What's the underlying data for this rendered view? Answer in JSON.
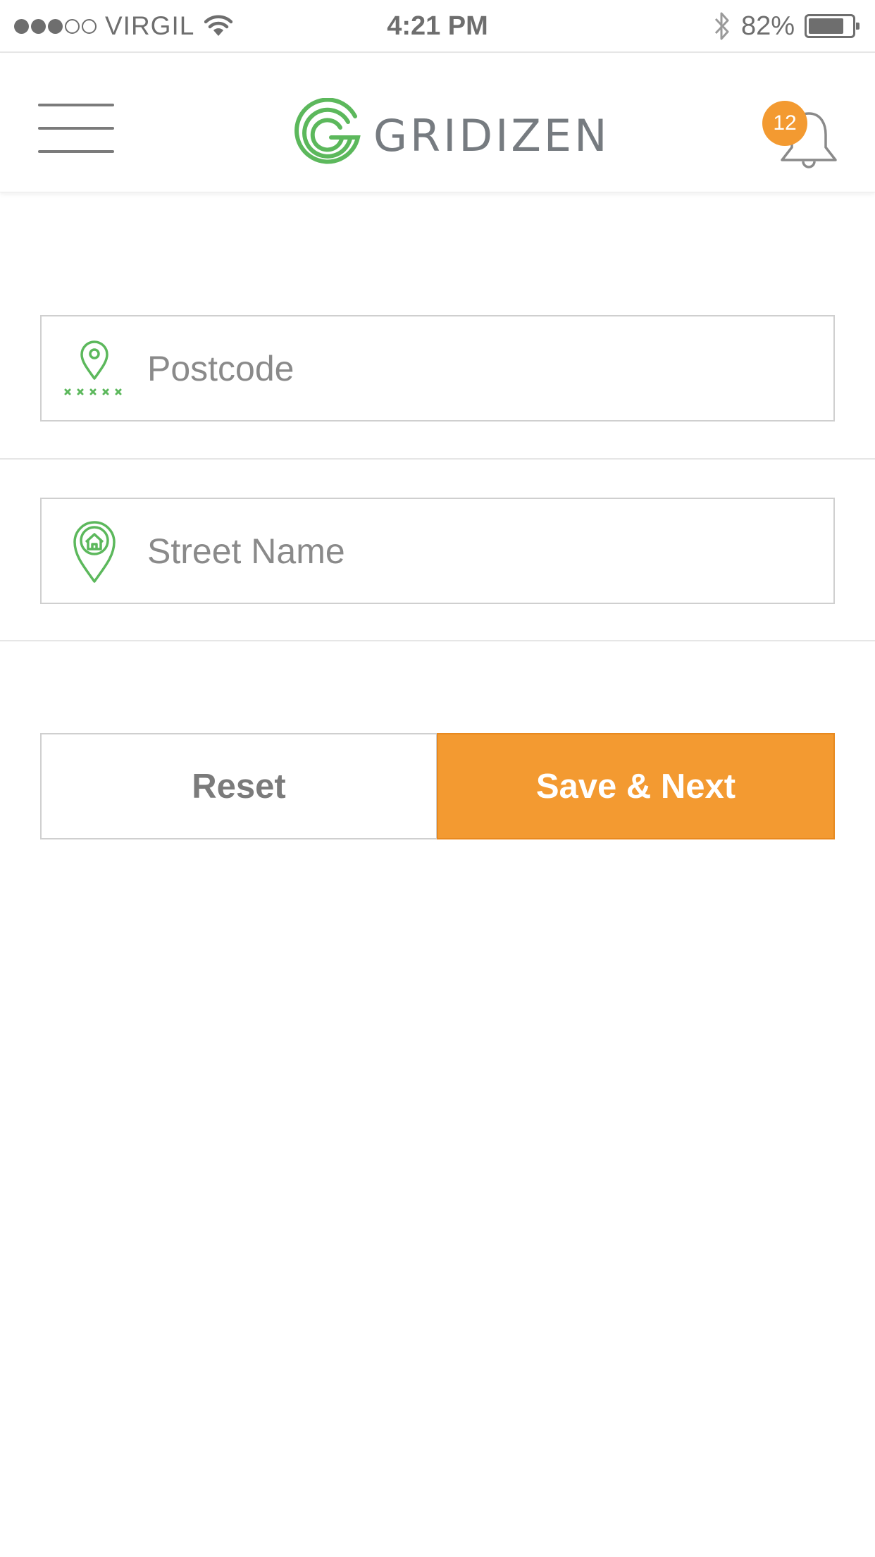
{
  "status_bar": {
    "signal_dots_total": 5,
    "signal_dots_filled": 3,
    "carrier": "VIRGIL",
    "wifi_icon": "wifi-icon",
    "time": "4:21 PM",
    "bluetooth_icon": "bluetooth-icon",
    "battery_percent": "82%",
    "battery_level": 0.82
  },
  "header": {
    "menu_icon": "hamburger-menu-icon",
    "logo_text": "GRIDIZEN",
    "logo_color": "#5cb85c",
    "notifications_icon": "bell-icon",
    "notification_count": "12",
    "badge_color": "#f39a31"
  },
  "form": {
    "postcode": {
      "placeholder": "Postcode",
      "value": "",
      "icon": "postcode-pin-icon"
    },
    "street_name": {
      "placeholder": "Street Name",
      "value": "",
      "icon": "house-pin-icon"
    }
  },
  "actions": {
    "reset_label": "Reset",
    "save_label": "Save & Next",
    "accent_color": "#f39a31"
  }
}
